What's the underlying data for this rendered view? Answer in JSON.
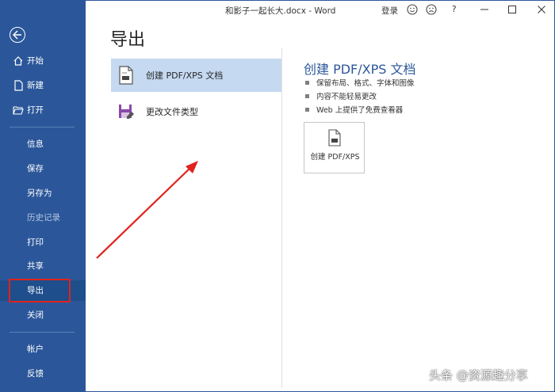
{
  "window": {
    "title": "和影子一起长大.docx - Word",
    "login_label": "登录",
    "help_label": "?"
  },
  "sidebar": {
    "back_icon": "back-arrow-icon",
    "items": [
      {
        "label": "开始",
        "icon": "home-icon"
      },
      {
        "label": "新建",
        "icon": "new-document-icon"
      },
      {
        "label": "打开",
        "icon": "folder-open-icon"
      },
      {
        "label": "信息"
      },
      {
        "label": "保存"
      },
      {
        "label": "另存为"
      },
      {
        "label": "历史记录",
        "disabled": true
      },
      {
        "label": "打印"
      },
      {
        "label": "共享"
      },
      {
        "label": "导出",
        "active": true
      },
      {
        "label": "关闭"
      },
      {
        "label": "帐户"
      },
      {
        "label": "反馈"
      }
    ]
  },
  "main": {
    "page_title": "导出",
    "export_options": [
      {
        "label": "创建 PDF/XPS 文档",
        "icon": "pdf-document-icon",
        "selected": true
      },
      {
        "label": "更改文件类型",
        "icon": "file-type-icon",
        "selected": false
      }
    ],
    "detail": {
      "title": "创建 PDF/XPS 文档",
      "bullets": [
        "保留布局、格式、字体和图像",
        "内容不能轻易更改",
        "Web 上提供了免费查看器"
      ],
      "button_label": "创建 PDF/XPS"
    }
  },
  "watermark": "头条 @资源趣分享",
  "colors": {
    "sidebar": "#2b579a",
    "selected": "#c5d9f1",
    "annotation": "#e0231d"
  }
}
